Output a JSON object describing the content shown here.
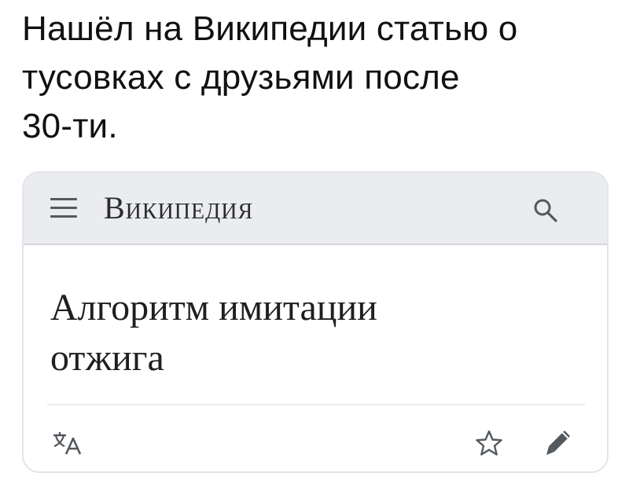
{
  "post": {
    "text_line1": "Нашёл на Википедии статью о",
    "text_line2": "тусовках с друзьями после",
    "text_line3": "30-ти."
  },
  "wiki": {
    "wordmark": "Википедия",
    "article_title_line1": "Алгоритм имитации",
    "article_title_line2": "отжига"
  },
  "icons": {
    "menu": "hamburger-menu-icon",
    "search": "search-icon",
    "translate": "language-translate-icon",
    "watch": "star-icon",
    "edit": "pencil-icon"
  },
  "colors": {
    "header_bg": "#eaecf0",
    "icon_gray": "#54595d",
    "text": "#1f1f1f"
  }
}
